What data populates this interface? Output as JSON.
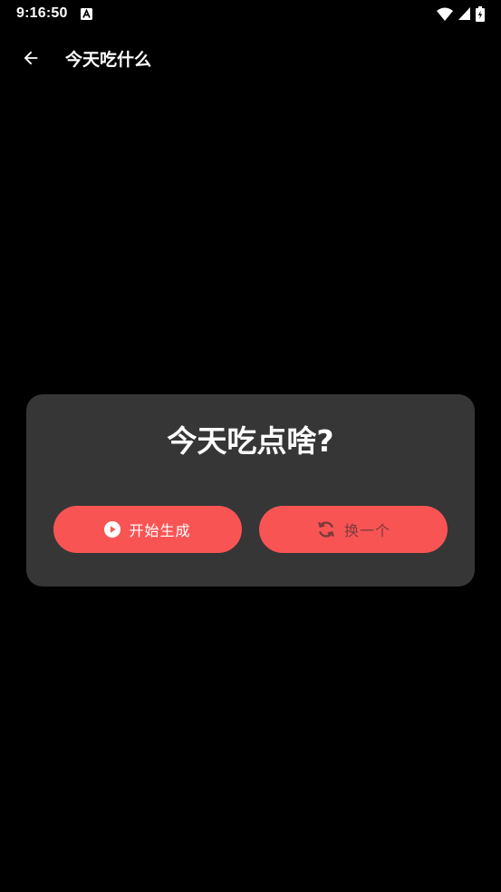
{
  "status_bar": {
    "time": "9:16:50",
    "notification_icon": "accessibility-a-icon",
    "icons": [
      "wifi-icon",
      "cell-signal-icon",
      "battery-charging-icon"
    ]
  },
  "app_bar": {
    "back_icon": "arrow-left-icon",
    "title": "今天吃什么"
  },
  "card": {
    "title": "今天吃点啥?",
    "start_button": {
      "icon": "play-circle-icon",
      "label": "开始生成"
    },
    "switch_button": {
      "icon": "refresh-icon",
      "label": "换一个"
    }
  },
  "colors": {
    "background": "#000000",
    "card": "#363636",
    "accent": "#f95454",
    "disabled_content": "#7a3b3b"
  }
}
